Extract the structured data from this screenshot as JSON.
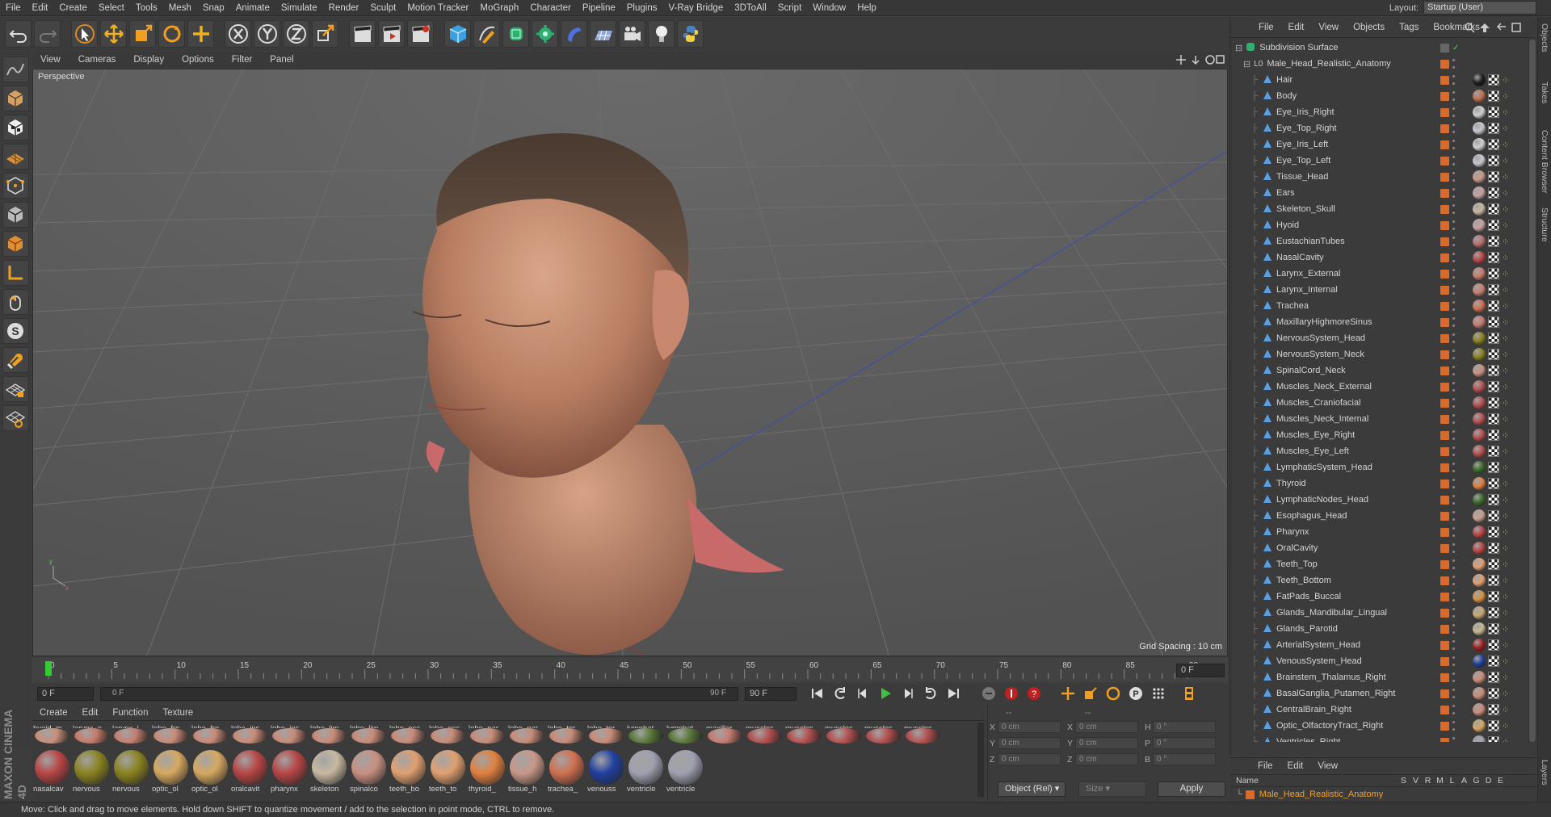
{
  "menubar": [
    "File",
    "Edit",
    "Create",
    "Select",
    "Tools",
    "Mesh",
    "Snap",
    "Animate",
    "Simulate",
    "Render",
    "Sculpt",
    "Motion Tracker",
    "MoGraph",
    "Character",
    "Pipeline",
    "Plugins",
    "V-Ray Bridge",
    "3DToAll",
    "Script",
    "Window",
    "Help"
  ],
  "layout": {
    "label": "Layout:",
    "value": "Startup (User)"
  },
  "viewport": {
    "menu": [
      "View",
      "Cameras",
      "Display",
      "Options",
      "Filter",
      "Panel"
    ],
    "label": "Perspective",
    "grid_spacing": "Grid Spacing : 10 cm"
  },
  "timeline": {
    "ticks": [
      "0",
      "5",
      "10",
      "15",
      "20",
      "25",
      "30",
      "35",
      "40",
      "45",
      "50",
      "55",
      "60",
      "65",
      "70",
      "75",
      "80",
      "85",
      "90"
    ],
    "current_frame_right": "0 F",
    "start_field": "0 F",
    "slider_start": "0 F",
    "slider_end": "90 F",
    "end_field": "90 F"
  },
  "materials": {
    "menu": [
      "Create",
      "Edit",
      "Function",
      "Texture"
    ],
    "row1": [
      {
        "label": "hyoid_m",
        "color": "#c98f7a"
      },
      {
        "label": "larynx_e",
        "color": "#c87b6a"
      },
      {
        "label": "larynx_i",
        "color": "#c77f70"
      },
      {
        "label": "lobe_fro",
        "color": "#c98b78"
      },
      {
        "label": "lobe_fro",
        "color": "#c98b78"
      },
      {
        "label": "lobe_ins",
        "color": "#c98b78"
      },
      {
        "label": "lobe_ins",
        "color": "#c98b78"
      },
      {
        "label": "lobe_lim",
        "color": "#c98b78"
      },
      {
        "label": "lobe_lim",
        "color": "#c98b78"
      },
      {
        "label": "lobe_occ",
        "color": "#c98b78"
      },
      {
        "label": "lobe_occ",
        "color": "#c98b78"
      },
      {
        "label": "lobe_par",
        "color": "#c98b78"
      },
      {
        "label": "lobe_par",
        "color": "#c98b78"
      },
      {
        "label": "lobe_ter",
        "color": "#c98b78"
      },
      {
        "label": "lobe_ter",
        "color": "#c98b78"
      },
      {
        "label": "lymphat",
        "color": "#5a7a3a"
      },
      {
        "label": "lymphat",
        "color": "#5a7a3a"
      },
      {
        "label": "maxillar",
        "color": "#c77a70"
      },
      {
        "label": "muscles",
        "color": "#b55050"
      },
      {
        "label": "muscles",
        "color": "#b55050"
      },
      {
        "label": "muscles",
        "color": "#b55050"
      },
      {
        "label": "muscles",
        "color": "#b55050"
      },
      {
        "label": "muscles",
        "color": "#b55050"
      }
    ],
    "row2": [
      {
        "label": "nasalcav",
        "color": "#b84545"
      },
      {
        "label": "nervous",
        "color": "#8a8220"
      },
      {
        "label": "nervous",
        "color": "#8a8220"
      },
      {
        "label": "optic_ol",
        "color": "#d6a860"
      },
      {
        "label": "optic_ol",
        "color": "#d6a860"
      },
      {
        "label": "oralcavit",
        "color": "#b84545"
      },
      {
        "label": "pharynx",
        "color": "#b84545"
      },
      {
        "label": "skeleton",
        "color": "#c8b8a0"
      },
      {
        "label": "spinalco",
        "color": "#c89080"
      },
      {
        "label": "teeth_bo",
        "color": "#e0a070"
      },
      {
        "label": "teeth_to",
        "color": "#e0a070"
      },
      {
        "label": "thyroid_",
        "color": "#e08040"
      },
      {
        "label": "tissue_h",
        "color": "#c89888"
      },
      {
        "label": "trachea_",
        "color": "#d07050"
      },
      {
        "label": "venouss",
        "color": "#2040a0"
      },
      {
        "label": "ventricle",
        "color": "#a0a0b0"
      },
      {
        "label": "ventricle",
        "color": "#a0a0b0"
      }
    ]
  },
  "coordinates": {
    "rows": [
      {
        "a": "X",
        "v1": "0 cm",
        "b": "X",
        "v2": "0 cm",
        "c": "H",
        "v3": "0 °"
      },
      {
        "a": "Y",
        "v1": "0 cm",
        "b": "Y",
        "v2": "0 cm",
        "c": "P",
        "v3": "0 °"
      },
      {
        "a": "Z",
        "v1": "0 cm",
        "b": "Z",
        "v2": "0 cm",
        "c": "B",
        "v3": "0 °"
      }
    ],
    "mode": "Object (Rel)",
    "size": "Size",
    "apply": "Apply",
    "dash1": "--",
    "dash2": "--"
  },
  "object_manager": {
    "menu": [
      "File",
      "Edit",
      "View",
      "Objects",
      "Tags",
      "Bookmarks"
    ],
    "root": "Subdivision Surface",
    "group": "Male_Head_Realistic_Anatomy",
    "objects": [
      {
        "name": "Hair",
        "tag": "#1c1c1c"
      },
      {
        "name": "Body",
        "tag": "#c07050"
      },
      {
        "name": "Eye_Iris_Right",
        "tag": "#d0d0d0"
      },
      {
        "name": "Eye_Top_Right",
        "tag": "#c8c8d0"
      },
      {
        "name": "Eye_Iris_Left",
        "tag": "#d0d0d0"
      },
      {
        "name": "Eye_Top_Left",
        "tag": "#c8c8d0"
      },
      {
        "name": "Tissue_Head",
        "tag": "#c89888"
      },
      {
        "name": "Ears",
        "tag": "#c8a0a0"
      },
      {
        "name": "Skeleton_Skull",
        "tag": "#c8b8a0"
      },
      {
        "name": "Hyoid",
        "tag": "#c8a0a0"
      },
      {
        "name": "EustachianTubes",
        "tag": "#b87070"
      },
      {
        "name": "NasalCavity",
        "tag": "#b84545"
      },
      {
        "name": "Larynx_External",
        "tag": "#c87b6a"
      },
      {
        "name": "Larynx_Internal",
        "tag": "#c77f70"
      },
      {
        "name": "Trachea",
        "tag": "#d07050"
      },
      {
        "name": "MaxillaryHighmoreSinus",
        "tag": "#c77a70"
      },
      {
        "name": "NervousSystem_Head",
        "tag": "#8a8220"
      },
      {
        "name": "NervousSystem_Neck",
        "tag": "#8a8220"
      },
      {
        "name": "SpinalCord_Neck",
        "tag": "#c89080"
      },
      {
        "name": "Muscles_Neck_External",
        "tag": "#b55050"
      },
      {
        "name": "Muscles_Craniofacial",
        "tag": "#b55050"
      },
      {
        "name": "Muscles_Neck_Internal",
        "tag": "#b55050"
      },
      {
        "name": "Muscles_Eye_Right",
        "tag": "#b55050"
      },
      {
        "name": "Muscles_Eye_Left",
        "tag": "#b55050"
      },
      {
        "name": "LymphaticSystem_Head",
        "tag": "#3a6a2a"
      },
      {
        "name": "Thyroid",
        "tag": "#e08040"
      },
      {
        "name": "LymphaticNodes_Head",
        "tag": "#3a6a2a"
      },
      {
        "name": "Esophagus_Head",
        "tag": "#c8a090"
      },
      {
        "name": "Pharynx",
        "tag": "#b84545"
      },
      {
        "name": "OralCavity",
        "tag": "#b84545"
      },
      {
        "name": "Teeth_Top",
        "tag": "#e0a070"
      },
      {
        "name": "Teeth_Bottom",
        "tag": "#e0a070"
      },
      {
        "name": "FatPads_Buccal",
        "tag": "#d69040"
      },
      {
        "name": "Glands_Mandibular_Lingual",
        "tag": "#c8a870"
      },
      {
        "name": "Glands_Parotid",
        "tag": "#c8b890"
      },
      {
        "name": "ArterialSystem_Head",
        "tag": "#a02020"
      },
      {
        "name": "VenousSystem_Head",
        "tag": "#2040a0"
      },
      {
        "name": "Brainstem_Thalamus_Right",
        "tag": "#c98b78"
      },
      {
        "name": "BasalGanglia_Putamen_Right",
        "tag": "#c98b78"
      },
      {
        "name": "CentralBrain_Right",
        "tag": "#c98b78"
      },
      {
        "name": "Optic_OlfactoryTract_Right",
        "tag": "#d6a860"
      },
      {
        "name": "Ventricles_Right",
        "tag": "#a0a0b0"
      }
    ]
  },
  "attributes": {
    "menu": [
      "File",
      "Edit",
      "View"
    ],
    "columns": [
      "Name",
      "S",
      "V",
      "R",
      "M",
      "L",
      "A",
      "G",
      "D",
      "E"
    ],
    "row": "Male_Head_Realistic_Anatomy"
  },
  "side_tabs": [
    "Objects",
    "Takes",
    "Content Browser",
    "Structure",
    "Layers"
  ],
  "status": "Move: Click and drag to move elements. Hold down SHIFT to quantize movement / add to the selection in point mode, CTRL to remove.",
  "brand": "MAXON CINEMA 4D"
}
